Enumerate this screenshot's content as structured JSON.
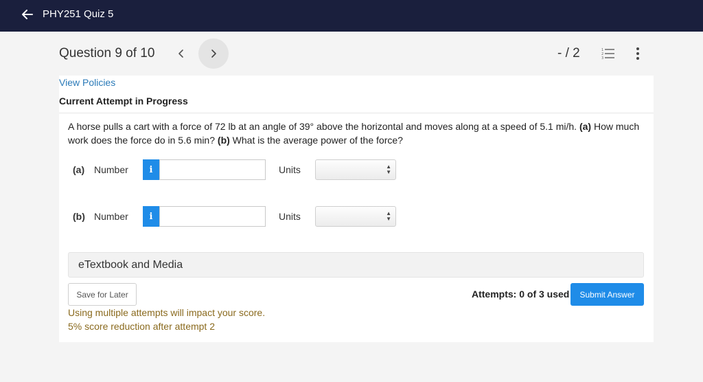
{
  "topbar": {
    "back_icon": "arrow-left-icon",
    "title": "PHY251 Quiz 5"
  },
  "question_header": {
    "title": "Question 9 of 10",
    "prev_icon": "chevron-left-icon",
    "next_icon": "chevron-right-icon",
    "score": "- / 2",
    "list_icon": "numbered-list-icon",
    "more_icon": "more-vertical-icon"
  },
  "card": {
    "view_policies": "View Policies",
    "attempt_status": "Current Attempt in Progress",
    "question": {
      "text_1": "A horse pulls a cart with a force of 72 lb at an angle of 39° above the horizontal and moves along at a speed of 5.1 mi/h. ",
      "part_a_marker": "(a)",
      "text_2": " How much work does the force do in 5.6 min? ",
      "part_b_marker": "(b)",
      "text_3": " What is the average power of the force?"
    },
    "answers": [
      {
        "part": "(a)",
        "number_label": "Number",
        "info_icon_glyph": "i",
        "value": "",
        "units_label": "Units",
        "units_selected": ""
      },
      {
        "part": "(b)",
        "number_label": "Number",
        "info_icon_glyph": "i",
        "value": "",
        "units_label": "Units",
        "units_selected": ""
      }
    ],
    "etextbook": "eTextbook and Media",
    "save_button": "Save for Later",
    "attempts": "Attempts: 0 of 3 used",
    "submit_button": "Submit Answer",
    "warning_1": "Using multiple attempts will impact your score.",
    "warning_2": "5% score reduction after attempt 2"
  },
  "colors": {
    "topbar_bg": "#1a1f3d",
    "accent_blue": "#1f8ce8",
    "link_blue": "#2a7ab8",
    "warning_text": "#8a6a1e"
  }
}
